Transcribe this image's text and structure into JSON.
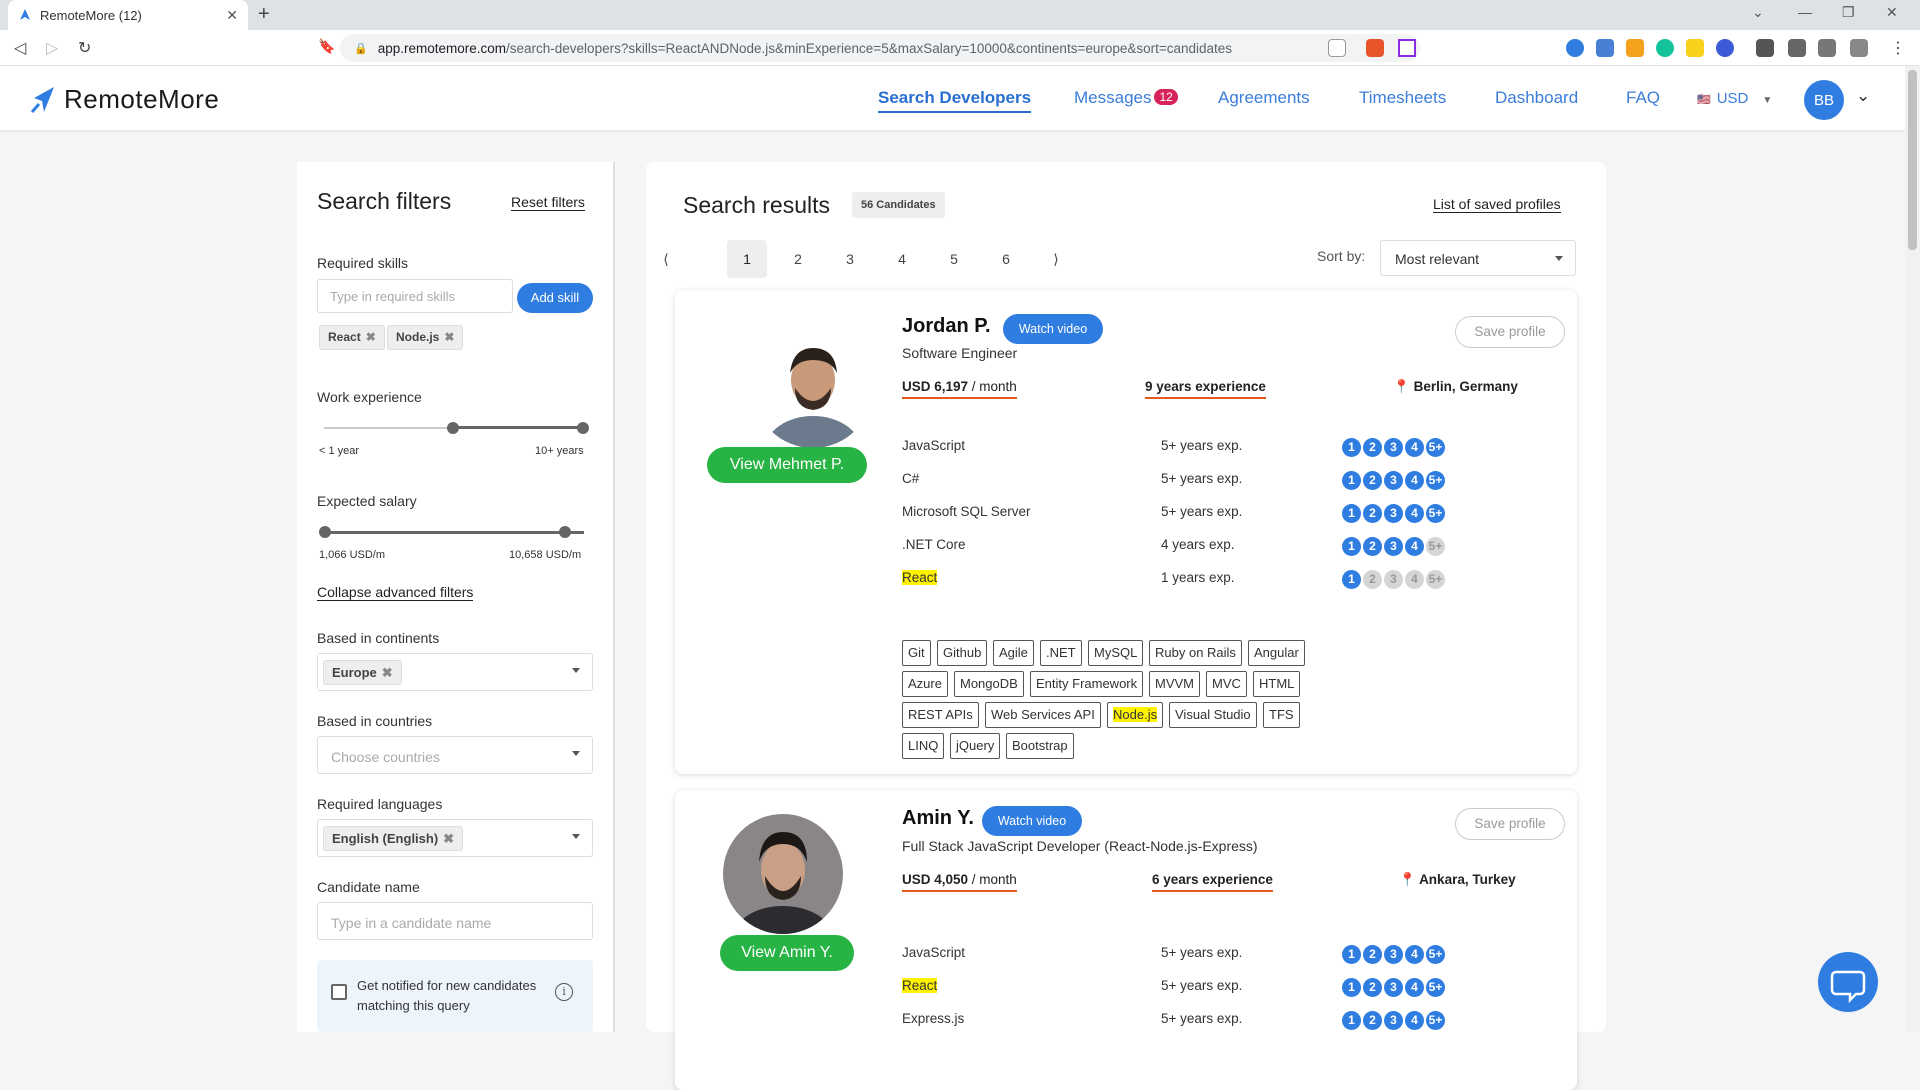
{
  "browser": {
    "tab_title": "RemoteMore (12)",
    "url_host": "app.remotemore.com",
    "url_path": "/search-developers?skills=ReactANDNode.js&minExperience=5&maxSalary=10000&continents=europe&sort=candidates"
  },
  "header": {
    "logo": "RemoteMore",
    "nav": [
      "Search Developers",
      "Messages",
      "Agreements",
      "Timesheets",
      "Dashboard",
      "FAQ"
    ],
    "messages_badge": "12",
    "currency": "USD",
    "avatar": "BB"
  },
  "filters": {
    "title": "Search filters",
    "reset": "Reset filters",
    "skills_label": "Required skills",
    "skills_placeholder": "Type in required skills",
    "add_skill": "Add skill",
    "skills": [
      "React",
      "Node.js"
    ],
    "experience_label": "Work experience",
    "exp_min_label": "< 1 year",
    "exp_max_label": "10+ years",
    "experience_range_years": [
      5,
      10
    ],
    "salary_label": "Expected salary",
    "salary_min_label": "1,066 USD/m",
    "salary_max_label": "10,658 USD/m",
    "collapse": "Collapse advanced filters",
    "continents_label": "Based in continents",
    "continent": "Europe",
    "countries_label": "Based in countries",
    "countries_placeholder": "Choose countries",
    "languages_label": "Required languages",
    "language": "English (English)",
    "candidate_label": "Candidate name",
    "candidate_placeholder": "Type in a candidate name",
    "notify": "Get notified for new candidates matching this query"
  },
  "results": {
    "title": "Search results",
    "count": "56 Candidates",
    "saved": "List of saved profiles",
    "pages": [
      "1",
      "2",
      "3",
      "4",
      "5",
      "6"
    ],
    "prev": "⟨",
    "next": "⟩",
    "sort_label": "Sort by:",
    "sort_value": "Most relevant"
  },
  "candidates": [
    {
      "name": "Jordan P.",
      "watch": "Watch video",
      "title": "Software Engineer",
      "salary": "USD 6,197",
      "per": " / month",
      "experience": "9 years experience",
      "location": "Berlin, Germany",
      "view": "View Mehmet P.",
      "save": "Save profile",
      "skills": [
        {
          "name": "JavaScript",
          "years": "5+ years exp.",
          "level": 5
        },
        {
          "name": "C#",
          "years": "5+ years exp.",
          "level": 5
        },
        {
          "name": "Microsoft SQL Server",
          "years": "5+ years exp.",
          "level": 5
        },
        {
          "name": ".NET Core",
          "years": "4 years exp.",
          "level": 4
        },
        {
          "name": "React",
          "years": "1 years exp.",
          "level": 1,
          "hl": true
        }
      ],
      "tags": [
        "Git",
        "Github",
        "Agile",
        ".NET",
        "MySQL",
        "Ruby on Rails",
        "Angular",
        "Azure",
        "MongoDB",
        "Entity Framework",
        "MVVM",
        "MVC",
        "HTML",
        "REST APIs",
        "Web Services API",
        "Node.js",
        "Visual Studio",
        "TFS",
        "LINQ",
        "jQuery",
        "Bootstrap"
      ]
    },
    {
      "name": "Amin Y.",
      "watch": "Watch video",
      "title": "Full Stack JavaScript Developer (React-Node.js-Express)",
      "salary": "USD 4,050",
      "per": " / month",
      "experience": "6 years experience",
      "location": "Ankara, Turkey",
      "view": "View Amin Y.",
      "save": "Save profile",
      "skills": [
        {
          "name": "JavaScript",
          "years": "5+ years exp.",
          "level": 5
        },
        {
          "name": "React",
          "years": "5+ years exp.",
          "level": 5,
          "hl": true
        },
        {
          "name": "Express.js",
          "years": "5+ years exp.",
          "level": 5
        }
      ]
    }
  ],
  "level_labels": [
    "1",
    "2",
    "3",
    "4",
    "5+"
  ]
}
